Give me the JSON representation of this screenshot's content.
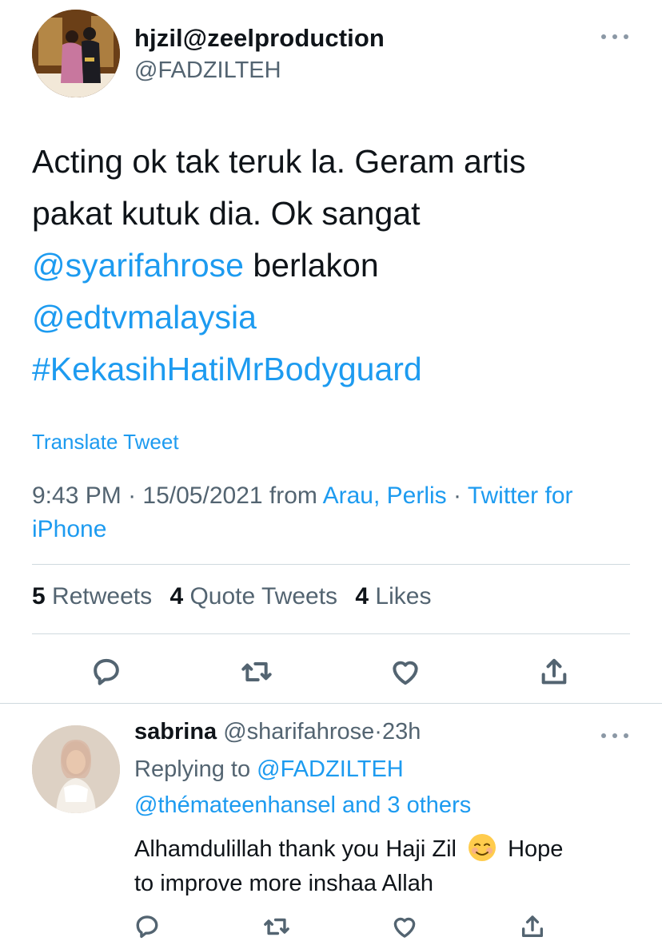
{
  "main_tweet": {
    "display_name": "hjzil@zeelproduction",
    "handle": "@FADZILTEH",
    "body_lines": [
      [
        {
          "t": "Acting ok tak teruk la. Geram artis",
          "link": false
        }
      ],
      [
        {
          "t": "pakat kutuk dia. Ok sangat",
          "link": false
        }
      ],
      [
        {
          "t": "@syarifahrose",
          "link": true
        },
        {
          "t": " berlakon",
          "link": false
        }
      ],
      [
        {
          "t": "@edtvmalaysia",
          "link": true
        }
      ],
      [
        {
          "t": "#KekasihHatiMrBodyguard",
          "link": true
        }
      ]
    ],
    "translate_label": "Translate Tweet",
    "time": "9:43 PM",
    "date": "15/05/2021",
    "from_label": "from",
    "location": "Arau, Perlis",
    "source_line1": "Twitter for",
    "source_line2": "iPhone",
    "stats": {
      "retweets_count": "5",
      "retweets_label": "Retweets",
      "quotes_count": "4",
      "quotes_label": "Quote Tweets",
      "likes_count": "4",
      "likes_label": "Likes"
    },
    "actions": [
      "reply-icon",
      "retweet-icon",
      "like-icon",
      "share-icon"
    ]
  },
  "reply_tweet": {
    "display_name": "sabrina",
    "handle": "@sharifahrose",
    "age": "23h",
    "replying_to_label": "Replying to",
    "replying_to_handle": "@FADZILTEH",
    "replying_to_more": "@thémateenhansel and 3 others",
    "text_before_emoji": "Alhamdulillah thank you Haji Zil",
    "emoji": "smiling-face-emoji",
    "text_after_emoji": "Hope",
    "text_line2": "to improve more inshaa Allah",
    "actions": [
      "reply-icon",
      "retweet-icon",
      "like-icon",
      "share-icon"
    ]
  },
  "colors": {
    "link": "#1d9bf0",
    "secondary_text": "#536471",
    "divider": "#cfd9de",
    "primary_text": "#0f1419"
  }
}
